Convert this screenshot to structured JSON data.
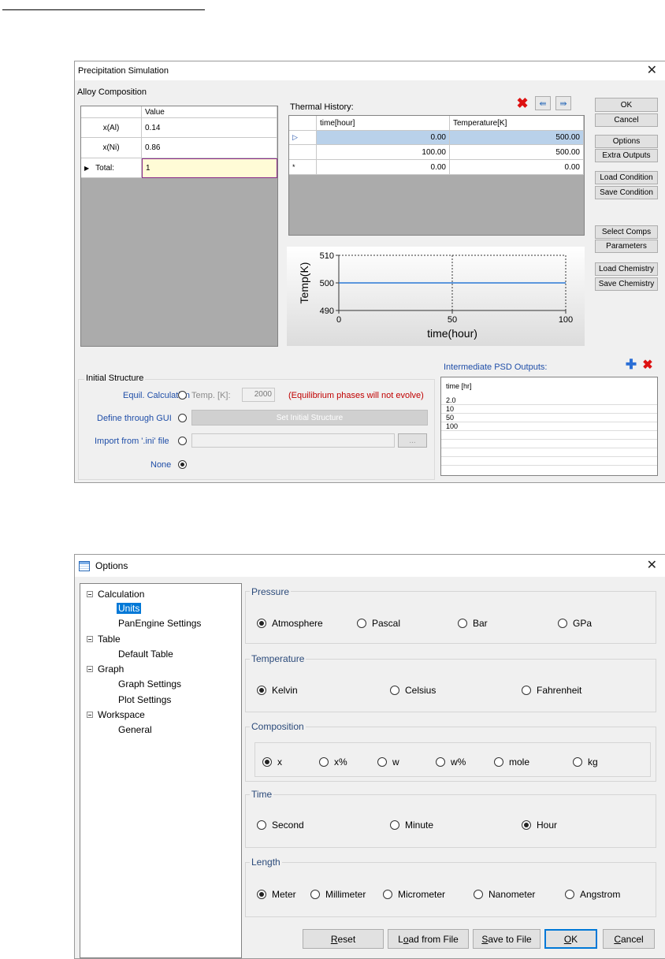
{
  "precip": {
    "title": "Precipitation Simulation",
    "alloy": {
      "section_label": "Alloy Composition",
      "value_header": "Value",
      "rows": [
        {
          "name": "x(Al)",
          "value": "0.14"
        },
        {
          "name": "x(Ni)",
          "value": "0.86"
        },
        {
          "name": "Total:",
          "value": "1"
        }
      ]
    },
    "thermal": {
      "label": "Thermal History:",
      "headers": [
        "time[hour]",
        "Temperature[K]"
      ],
      "rows": [
        {
          "time": "0.00",
          "temp": "500.00"
        },
        {
          "time": "100.00",
          "temp": "500.00"
        },
        {
          "marker": "*",
          "time": "0.00",
          "temp": "0.00"
        }
      ]
    },
    "chart": {
      "ylabel": "Temp(K)",
      "xlabel": "time(hour)",
      "y_ticks": [
        "510",
        "500",
        "490"
      ],
      "x_ticks": [
        "0",
        "50",
        "100"
      ]
    },
    "chart_data": {
      "type": "line",
      "x": [
        0,
        100
      ],
      "series": [
        {
          "values": [
            500,
            500
          ]
        }
      ],
      "xlabel": "time(hour)",
      "ylabel": "Temp(K)",
      "xlim": [
        0,
        100
      ],
      "ylim": [
        490,
        510
      ],
      "grid": true
    },
    "buttons": {
      "ok": "OK",
      "cancel": "Cancel",
      "options": "Options",
      "extra_outputs": "Extra Outputs",
      "load_condition": "Load Condition",
      "save_condition": "Save Condition",
      "select_comps": "Select Comps",
      "parameters": "Parameters",
      "load_chemistry": "Load Chemistry",
      "save_chemistry": "Save Chemistry"
    },
    "initial": {
      "label": "Initial Structure",
      "equil": "Equil. Calculation",
      "temp_label": "Temp. [K]:",
      "temp_value": "2000",
      "equil_note": "(Equilibrium phases will not evolve)",
      "gui": "Define through GUI",
      "set_button": "Set Initial Structure",
      "ini": "Import from '.ini' file",
      "browse": "...",
      "none": "None"
    },
    "psd": {
      "label": "Intermediate PSD Outputs:",
      "header": "time [hr]",
      "values": [
        "2.0",
        "10",
        "50",
        "100"
      ]
    }
  },
  "options": {
    "title": "Options",
    "tree": [
      {
        "label": "Calculation",
        "children": [
          "Units",
          "PanEngine Settings"
        ]
      },
      {
        "label": "Table",
        "children": [
          "Default Table"
        ]
      },
      {
        "label": "Graph",
        "children": [
          "Graph Settings",
          "Plot Settings"
        ]
      },
      {
        "label": "Workspace",
        "children": [
          "General"
        ]
      }
    ],
    "selected": "Units",
    "pressure": {
      "label": "Pressure",
      "options": [
        "Atmosphere",
        "Pascal",
        "Bar",
        "GPa"
      ],
      "selected": "Atmosphere"
    },
    "temperature": {
      "label": "Temperature",
      "options": [
        "Kelvin",
        "Celsius",
        "Fahrenheit"
      ],
      "selected": "Kelvin"
    },
    "composition": {
      "label": "Composition",
      "options": [
        "x",
        "x%",
        "w",
        "w%",
        "mole",
        "kg"
      ],
      "selected": "x"
    },
    "time": {
      "label": "Time",
      "options": [
        "Second",
        "Minute",
        "Hour"
      ],
      "selected": "Hour"
    },
    "length": {
      "label": "Length",
      "options": [
        "Meter",
        "Millimeter",
        "Micrometer",
        "Nanometer",
        "Angstrom"
      ],
      "selected": "Meter"
    },
    "buttons": {
      "reset": [
        "R",
        "eset"
      ],
      "load": [
        "L",
        "o",
        "ad from File"
      ],
      "save": [
        "S",
        "ave to File"
      ],
      "ok": [
        "O",
        "K"
      ],
      "cancel": [
        "C",
        "ancel"
      ]
    }
  }
}
